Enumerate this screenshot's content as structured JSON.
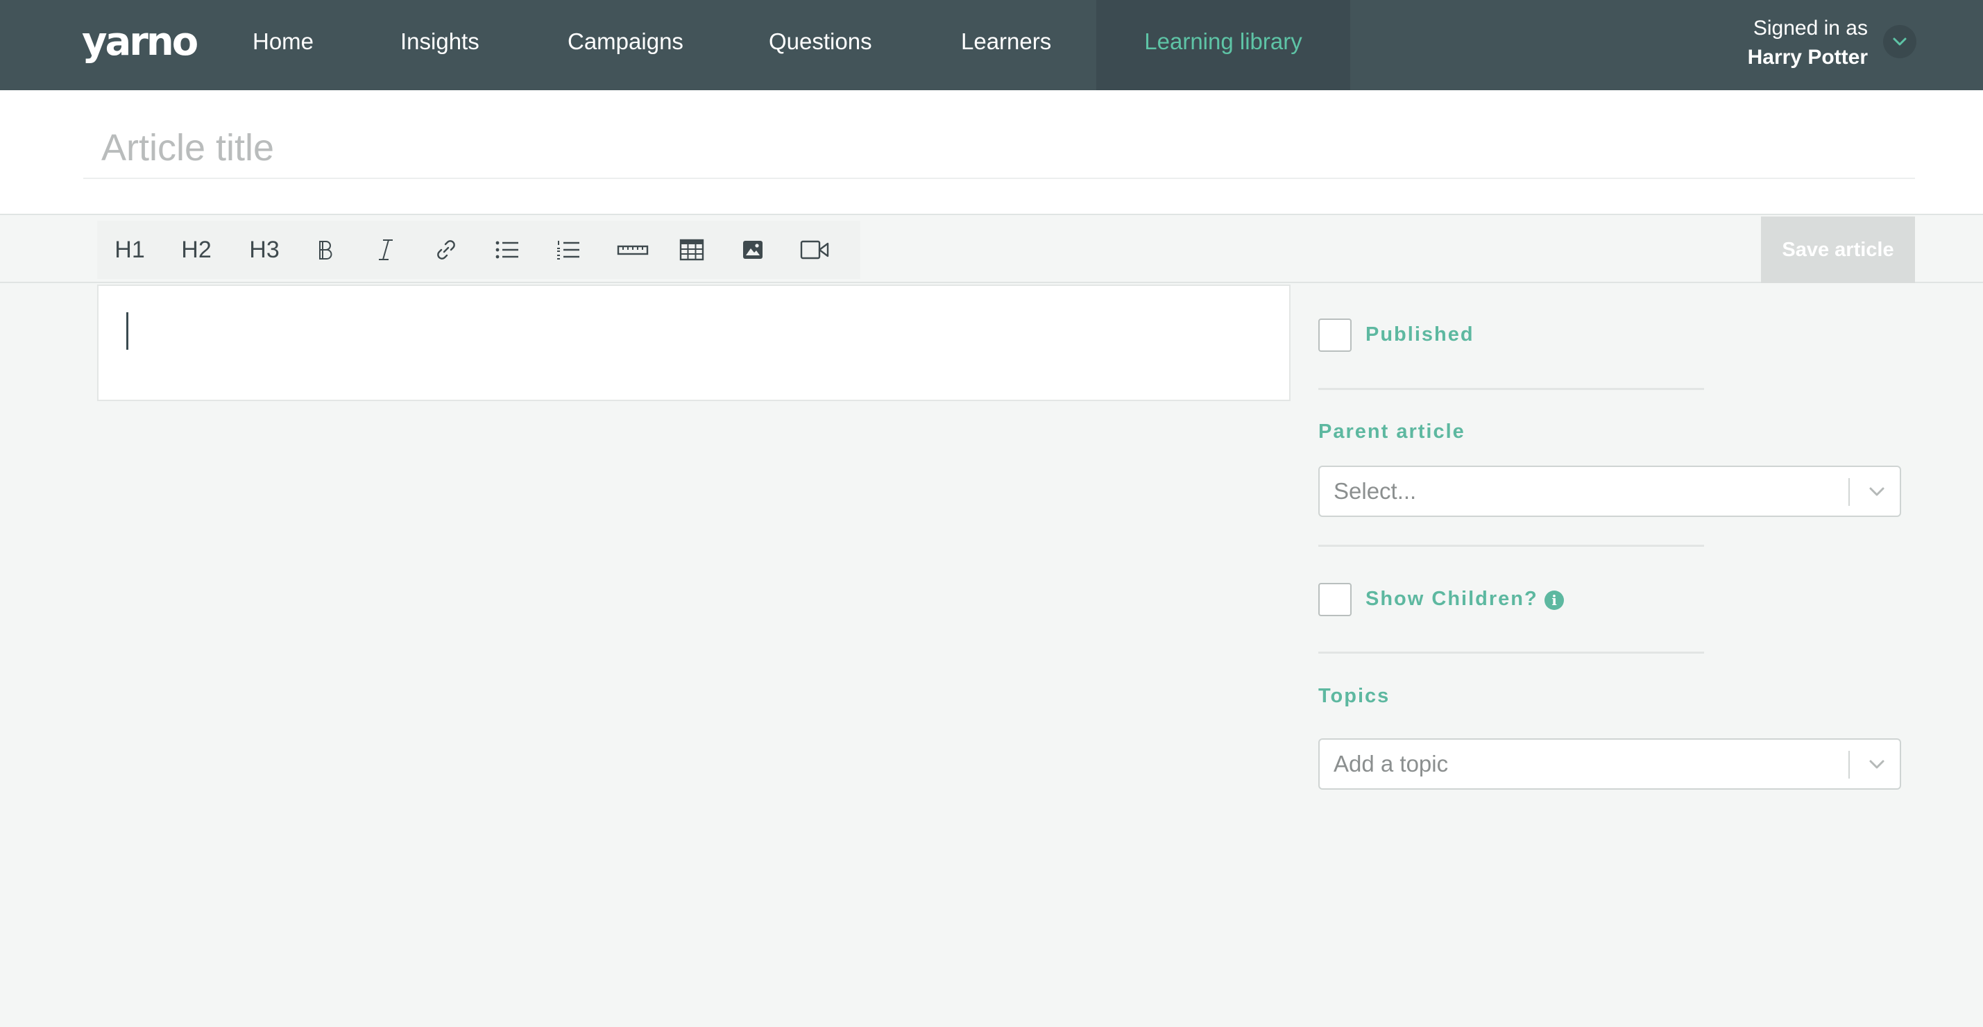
{
  "brand": {
    "logo_text": "yarno"
  },
  "nav": {
    "items": [
      {
        "label": "Home"
      },
      {
        "label": "Insights"
      },
      {
        "label": "Campaigns"
      },
      {
        "label": "Questions"
      },
      {
        "label": "Learners"
      },
      {
        "label": "Learning library",
        "active": true
      }
    ]
  },
  "user": {
    "signed_in_label": "Signed in as",
    "name": "Harry Potter"
  },
  "article": {
    "title_placeholder": "Article title"
  },
  "toolbar": {
    "h1": "H1",
    "h2": "H2",
    "h3": "H3",
    "icons": [
      "bold-icon",
      "italic-icon",
      "link-icon",
      "bullet-list-icon",
      "numbered-list-icon",
      "horizontal-rule-icon",
      "table-icon",
      "image-icon",
      "video-icon"
    ],
    "save_label": "Save article"
  },
  "sidebar": {
    "published_label": "Published",
    "parent_article_label": "Parent article",
    "parent_article_placeholder": "Select...",
    "show_children_label": "Show Children?",
    "topics_label": "Topics",
    "topics_placeholder": "Add a topic"
  },
  "colors": {
    "nav_bg": "#435459",
    "nav_active_bg": "#3c4b51",
    "accent": "#5ec4a6",
    "label_green": "#5db8a0",
    "page_bg": "#f4f6f5",
    "save_disabled": "#d9dcdb"
  }
}
